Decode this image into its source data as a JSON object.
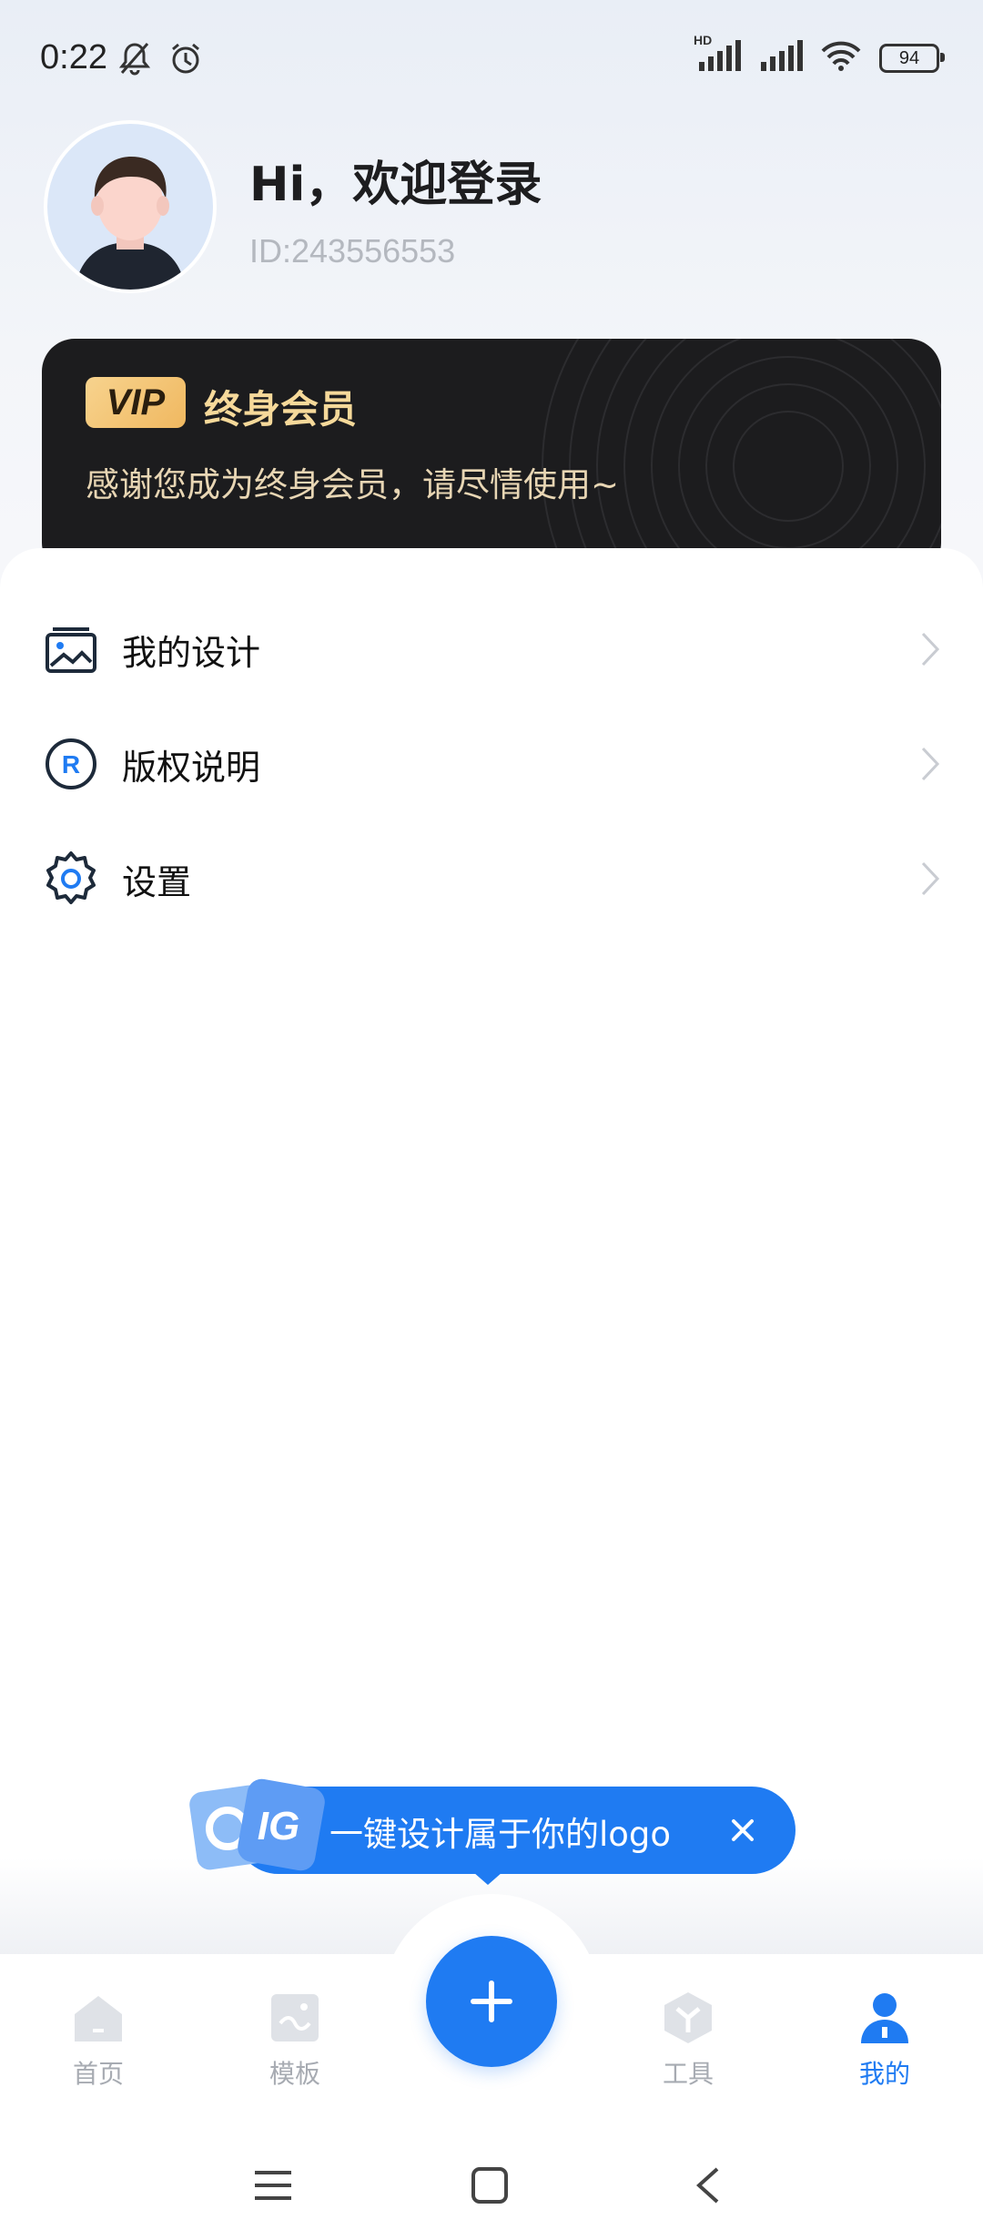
{
  "status_bar": {
    "time": "0:22",
    "battery": "94",
    "hd_label": "HD",
    "icons": [
      "silent-bell-icon",
      "alarm-icon",
      "signal-icon",
      "signal-icon",
      "wifi-icon",
      "battery-icon"
    ]
  },
  "profile": {
    "greeting": "Hi，欢迎登录",
    "user_id": "ID:243556553"
  },
  "vip": {
    "badge": "VIP",
    "title": "终身会员",
    "description": "感谢您成为终身会员，请尽情使用~"
  },
  "menu": {
    "items": [
      {
        "label": "我的设计",
        "icon": "image-gallery-icon"
      },
      {
        "label": "版权说明",
        "icon": "registered-icon"
      },
      {
        "label": "设置",
        "icon": "gear-icon"
      }
    ]
  },
  "promo": {
    "text": "一键设计属于你的logo",
    "close": "×"
  },
  "bottom_nav": {
    "items": [
      {
        "label": "首页",
        "icon": "home-icon",
        "active": false
      },
      {
        "label": "模板",
        "icon": "template-icon",
        "active": false
      },
      {
        "label": "工具",
        "icon": "tools-icon",
        "active": false
      },
      {
        "label": "我的",
        "icon": "profile-icon",
        "active": true
      }
    ],
    "fab_icon": "plus-icon"
  },
  "colors": {
    "accent": "#1f7bf2",
    "vip_gold": "#f6d99a",
    "inactive": "#a7abb2"
  }
}
